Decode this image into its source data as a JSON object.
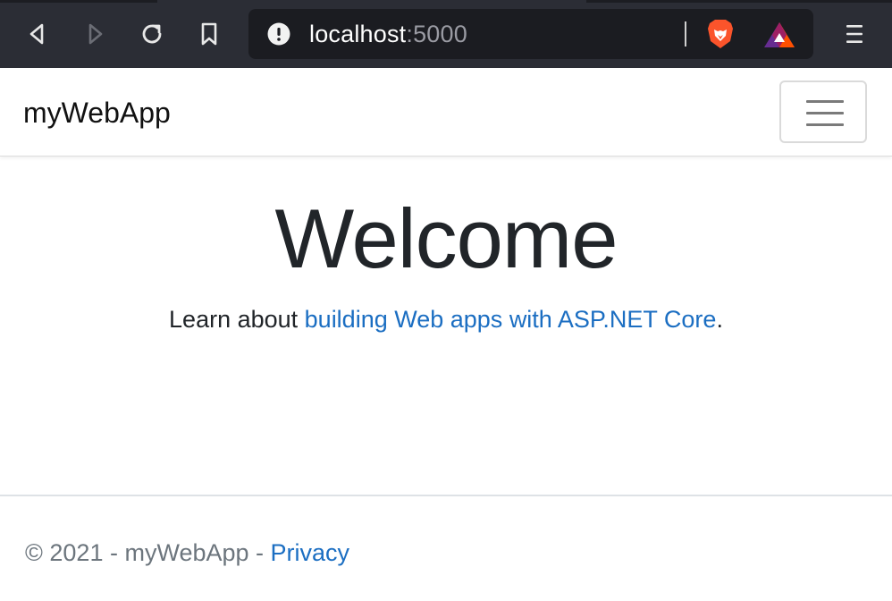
{
  "browser": {
    "url_host": "localhost",
    "url_port": ":5000",
    "icons": {
      "back": "back-arrow-icon",
      "forward": "forward-arrow-icon",
      "reload": "reload-icon",
      "bookmark": "bookmark-icon",
      "site_info": "info-icon",
      "brave_shields": "brave-lion-icon",
      "brave_rewards": "bat-triangle-icon",
      "menu": "hamburger-menu-icon"
    }
  },
  "navbar": {
    "brand": "myWebApp",
    "toggler_icon": "hamburger-icon"
  },
  "main": {
    "title": "Welcome",
    "lead_prefix": "Learn about ",
    "lead_link": "building Web apps with ASP.NET Core",
    "lead_suffix": "."
  },
  "footer": {
    "copyright": "© 2021 - myWebApp - ",
    "privacy_link": "Privacy"
  },
  "colors": {
    "chrome_bg": "#2b2d35",
    "urlbar_bg": "#1b1c21",
    "link": "#1b6ec2",
    "text": "#212529",
    "muted": "#6c757d"
  }
}
